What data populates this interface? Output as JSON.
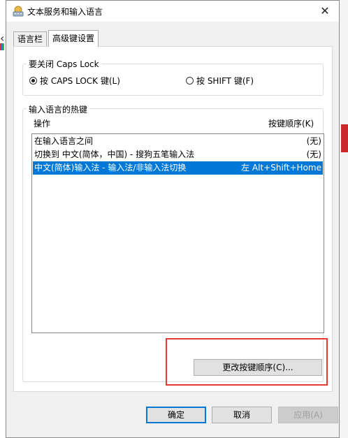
{
  "window": {
    "title": "文本服务和输入语言",
    "close_glyph": "✕"
  },
  "tabs": [
    {
      "label": "语言栏",
      "active": false
    },
    {
      "label": "高级键设置",
      "active": true
    }
  ],
  "caps_group": {
    "label": "要关闭 Caps Lock",
    "options": [
      {
        "label": "按 CAPS LOCK 键(L)",
        "checked": true
      },
      {
        "label": "按 SHIFT 键(F)",
        "checked": false
      }
    ]
  },
  "hotkey_group": {
    "label": "输入语言的热键",
    "col_action": "操作",
    "col_key": "按键顺序(K)",
    "rows": [
      {
        "action": "在输入语言之间",
        "key": "(无)",
        "selected": false
      },
      {
        "action": "切换到 中文(简体，中国) - 搜狗五笔输入法",
        "key": "(无)",
        "selected": false
      },
      {
        "action": "中文(简体)输入法 - 输入法/非输入法切换",
        "key": "左 Alt+Shift+Home",
        "selected": true
      }
    ],
    "change_button": "更改按键顺序(C)..."
  },
  "footer": {
    "ok": "确定",
    "cancel": "取消",
    "apply": "应用(A)"
  },
  "colors": {
    "selection": "#0078d7",
    "annotation": "#e53935"
  }
}
